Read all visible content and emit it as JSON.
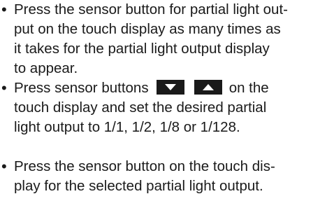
{
  "items": [
    {
      "lines": [
        "Press the sensor button for partial light out-",
        "put on the touch display as many times as",
        "it takes for the partial light output display",
        "to appear."
      ]
    },
    {
      "line1_before_icons": "Press sensor buttons",
      "line1_after_icons": "on the",
      "lines": [
        "touch display and set the desired partial",
        "light output to 1/1, 1/2, 1/8 or 1/128."
      ],
      "icons": [
        "triangle-down-icon",
        "triangle-up-icon"
      ]
    },
    {
      "lines": [
        "Press the sensor button on the touch dis-",
        "play for the selected partial light output."
      ]
    }
  ],
  "bullet": "•"
}
